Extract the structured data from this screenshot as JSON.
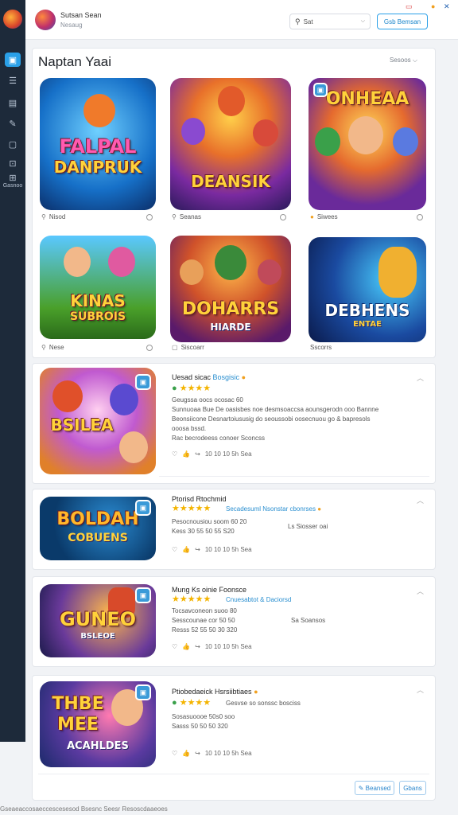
{
  "sidebar": {
    "items": [
      "app-icon",
      "list-icon",
      "chart-icon",
      "tag-icon",
      "chat-icon",
      "gamepad-icon"
    ],
    "label": "Gasnoo"
  },
  "topbar": {
    "user_name": "Sutsan Sean",
    "user_sub": "Nesaug",
    "search_value": "Sat",
    "button_label": "Gsb Bemsan"
  },
  "featured": {
    "title": "Naptan Yaai",
    "sort_label": "Sesoos",
    "tiles": [
      {
        "title": "FALPAL",
        "subtitle": "DANPRUK",
        "meta": "Nisod"
      },
      {
        "title": "DEANSIK",
        "subtitle": "",
        "meta": "Seanas"
      },
      {
        "title": "ONHEAA",
        "subtitle": "",
        "meta": "Siwees"
      },
      {
        "title": "KINAS",
        "subtitle": "SUBROIS",
        "meta": "Nese"
      },
      {
        "title": "DOHARRS",
        "subtitle": "HIARDE",
        "meta": "Siscoarr"
      },
      {
        "title": "DEBHENS",
        "subtitle": "ENTAE",
        "meta": "Sscorrs"
      }
    ]
  },
  "list": [
    {
      "title": "Uesad sicac",
      "title_hint": "Bosgisic",
      "line1": "Geugssa oocs ocosac 60",
      "line2": "Sunnuoaa Bue De oasisbes noe desmsoaccsa aounsgerodn ooo Bannne",
      "line3": "Beonsiicone Desnartoiususig do seoussobi oosecnuou go & bapresols",
      "line4": "ooosa bssd.",
      "line5": "Rac becrodeess conoer Sconcss",
      "actions": "10 10 10 5h Sea"
    },
    {
      "title": "Ptorisd Rtochmid",
      "title_hint": "Secadesuml Nsonstar cbonrses",
      "line1": "Pesocnousiou soom 60 20",
      "line2": "Kess 30 55 50 55 S20",
      "right": "Ls Siosser oai",
      "actions": "10 10 10 5h Sea"
    },
    {
      "title": "Mung Ks oinie Foonsce",
      "title_hint": "Cnuesabtot & Daciorsd",
      "line1": "Tocsavconeon suoo 80",
      "line2": "Sesscounae cor 50 50",
      "line3": "Resss 52 55 50 30 320",
      "right": "Sa Soansos",
      "actions": "10 10 10 5h Sea"
    },
    {
      "title": "Ptiobedaeick Hsrsiibtiaes",
      "line1": "Gesvse so sonssc bosciss",
      "line2": "Sosasuoooe 50s0 soo",
      "line3": "Sasss 50 50 50 320",
      "actions": "10 10 10 5h Sea"
    }
  ],
  "bottom_buttons": [
    "Beansed",
    "Gbans"
  ],
  "footer": "Gseaeaccosaeccescesesod Bsesnc Seesr Resoscdaaeoes",
  "colors": {
    "accent": "#2aa0e8",
    "star": "#f4b400",
    "rail": "#1d2a3a"
  }
}
